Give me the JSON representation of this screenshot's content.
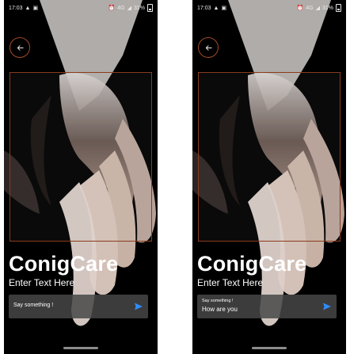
{
  "status_bar": {
    "time": "17:03",
    "battery": "31%",
    "signal_text": "4G"
  },
  "app": {
    "title": "ConigCare",
    "subtitle": "Enter Text Here"
  },
  "screens": {
    "left": {
      "input_placeholder": "Say something !"
    },
    "right": {
      "input_label": "Say something !",
      "input_value": "How are you"
    }
  },
  "colors": {
    "frame_accent": "#8a3b1d",
    "send_blue": "#2f8cff"
  },
  "icons": {
    "back": "arrow-left-icon",
    "send": "send-icon"
  }
}
